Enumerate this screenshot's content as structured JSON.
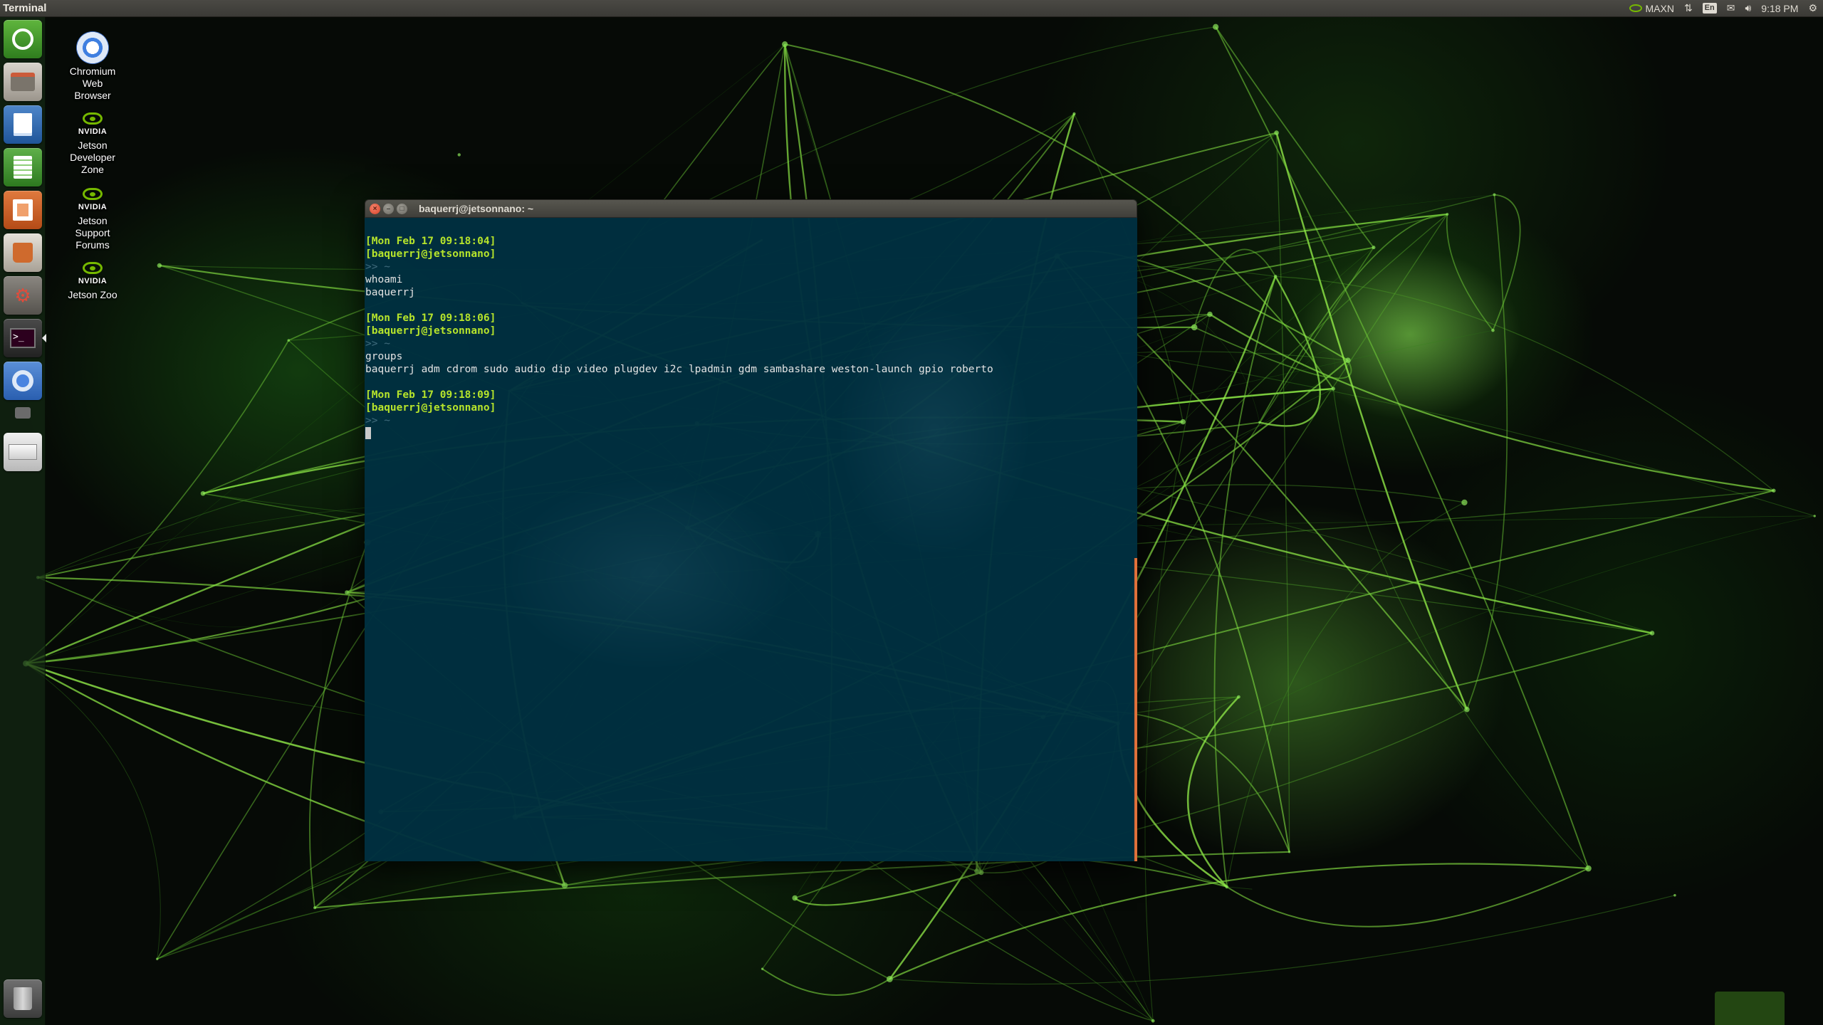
{
  "top_panel": {
    "app_title": "Terminal",
    "power_mode": "MAXN",
    "keyboard_layout": "En",
    "clock": "9:18 PM"
  },
  "desktop_icons": [
    {
      "label_lines": [
        "Chromium",
        "Web",
        "Browser"
      ],
      "icon": "chromium-icon"
    },
    {
      "label_lines": [
        "Jetson",
        "Developer",
        "Zone"
      ],
      "icon": "nvidia-icon",
      "brand": "NVIDIA"
    },
    {
      "label_lines": [
        "Jetson",
        "Support",
        "Forums"
      ],
      "icon": "nvidia-icon",
      "brand": "NVIDIA"
    },
    {
      "label_lines": [
        "Jetson Zoo"
      ],
      "icon": "nvidia-icon",
      "brand": "NVIDIA"
    }
  ],
  "launcher": {
    "items": [
      "ubuntu-dash-icon",
      "files-icon",
      "writer-icon",
      "calc-icon",
      "impress-icon",
      "software-center-icon",
      "system-settings-icon",
      "terminal-icon",
      "chromium-icon",
      "camera-icon",
      "drive-icon"
    ],
    "trash": "trash-icon"
  },
  "terminal": {
    "title": "baquerrj@jetsonnano: ~",
    "lines": [
      {
        "kind": "ts",
        "text": "[Mon Feb 17 09:18:04]"
      },
      {
        "kind": "user",
        "text": "[baquerrj@jetsonnano]"
      },
      {
        "kind": "prompt",
        "text": ">> ~"
      },
      {
        "kind": "out",
        "text": "whoami"
      },
      {
        "kind": "out",
        "text": "baquerrj"
      },
      {
        "kind": "gap",
        "text": ""
      },
      {
        "kind": "ts",
        "text": "[Mon Feb 17 09:18:06]"
      },
      {
        "kind": "user",
        "text": "[baquerrj@jetsonnano]"
      },
      {
        "kind": "prompt",
        "text": ">> ~"
      },
      {
        "kind": "out",
        "text": "groups"
      },
      {
        "kind": "out",
        "text": "baquerrj adm cdrom sudo audio dip video plugdev i2c lpadmin gdm sambashare weston-launch gpio roberto"
      },
      {
        "kind": "gap",
        "text": ""
      },
      {
        "kind": "ts",
        "text": "[Mon Feb 17 09:18:09]"
      },
      {
        "kind": "user",
        "text": "[baquerrj@jetsonnano]"
      },
      {
        "kind": "prompt",
        "text": ">> ~"
      }
    ]
  },
  "colors": {
    "terminal_bg": "#003040",
    "prompt_green": "#b7e52b",
    "nvidia_green": "#76b900",
    "scrollbar": "#e0703a"
  }
}
